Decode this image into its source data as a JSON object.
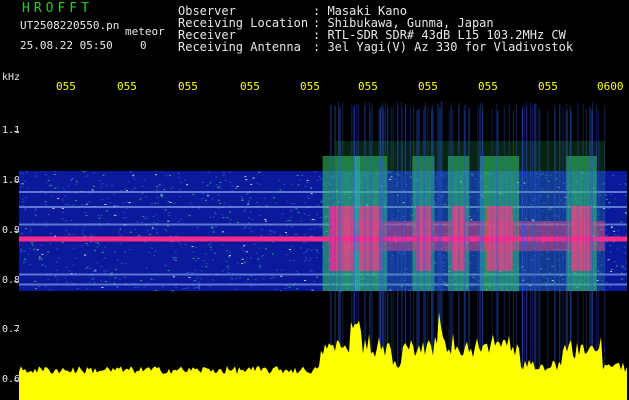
{
  "header": {
    "title": "HROFFT",
    "file_name": "UT2508220550.pn",
    "meteor_label": "meteor",
    "date_time": "25.08.22 05:50",
    "count": "0"
  },
  "info": [
    {
      "label": "Observer",
      "value": ": Masaki Kano"
    },
    {
      "label": "Receiving Location",
      "value": ": Shibukawa, Gunma, Japan"
    },
    {
      "label": "Receiver",
      "value": ": RTL-SDR SDR# 43dB L15 103.2MHz CW"
    },
    {
      "label": "Receiving Antenna",
      "value": ": 3el Yagi(V) Az 330 for Vladivostok"
    }
  ],
  "axis": {
    "unit": "kHz",
    "y_labels": [
      "1.1",
      "1.0",
      "0.9",
      "0.8",
      "0.7",
      "0.6"
    ],
    "time_labels": [
      "055",
      "055",
      "055",
      "055",
      "055",
      "055",
      "055",
      "055",
      "055",
      "0600"
    ]
  },
  "colors": {
    "background": "#000000",
    "text": "#e8e8e8",
    "title": "#22cc22",
    "time_axis": "#ffff00",
    "noise_low": "#0a1a9a",
    "noise_mid": "#2a5ae0",
    "noise_high": "#33cc66",
    "echo": "#ff2a8a",
    "amplitude": "#ffff00"
  },
  "chart_data": {
    "type": "heatmap",
    "xlabel": "",
    "ylabel": "kHz",
    "y_ticks": [
      1.1,
      1.0,
      0.9,
      0.8,
      0.7,
      0.6
    ],
    "ylim": [
      0.6,
      1.15
    ],
    "x_tick_labels": [
      "055",
      "055",
      "055",
      "055",
      "055",
      "055",
      "055",
      "055",
      "055",
      "0600"
    ],
    "noise_band_khz": [
      0.78,
      1.02
    ],
    "carrier_khz": 0.885,
    "carrier_lines_khz": [
      0.98,
      0.95,
      0.915,
      0.815,
      0.795
    ],
    "echo_minutes": [
      5.5,
      6.0,
      6.9,
      7.5,
      8.2,
      9.6
    ]
  }
}
